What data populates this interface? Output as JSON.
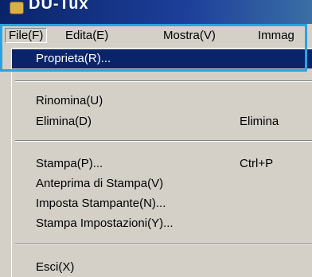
{
  "window": {
    "title": "DU-Tux"
  },
  "menubar": {
    "file": "File(F)",
    "edit": "Edita(E)",
    "view": "Mostra(V)",
    "image": "Immag"
  },
  "dropdown": {
    "properties": "Proprieta(R)...",
    "rename": "Rinomina(U)",
    "delete": "Elimina(D)",
    "delete_shortcut": "Elimina",
    "print": "Stampa(P)...",
    "print_shortcut": "Ctrl+P",
    "print_preview": "Anteprima di Stampa(V)",
    "printer_setup": "Imposta Stampante(N)...",
    "print_settings": "Stampa Impostazioni(Y)...",
    "exit": "Esci(X)"
  },
  "colors": {
    "selection": "#0a246a",
    "highlight_frame": "#27a3e3"
  }
}
